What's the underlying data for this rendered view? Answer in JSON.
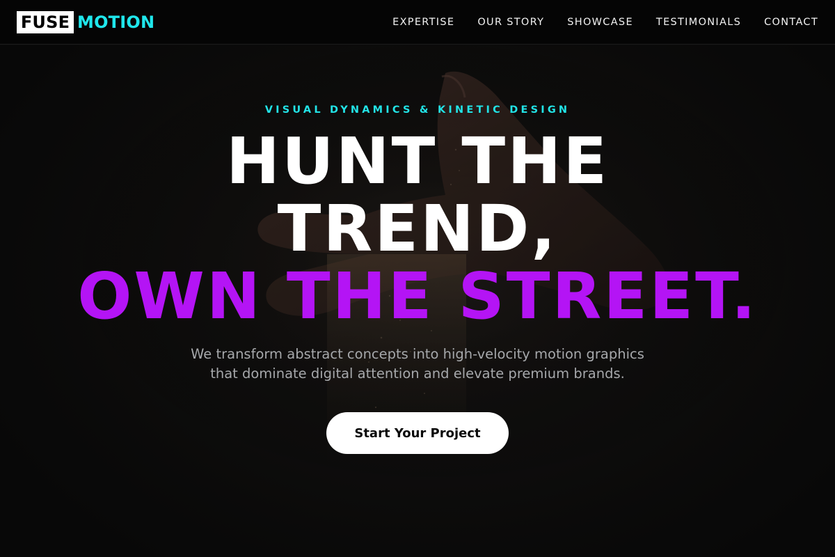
{
  "brand": {
    "logo_part1": "FUSE",
    "logo_part2": "MOTION",
    "accent_color": "#1fe7ec"
  },
  "nav": {
    "items": [
      "EXPERTISE",
      "OUR STORY",
      "SHOWCASE",
      "TESTIMONIALS",
      "CONTACT"
    ]
  },
  "hero": {
    "eyebrow": "VISUAL DYNAMICS & KINETIC DESIGN",
    "headline_line1": "HUNT THE",
    "headline_line2": "TREND,",
    "headline_line3": "OWN THE STREET.",
    "headline_accent_color": "#b414f5",
    "subtext_line1": "We transform abstract concepts into high-velocity motion graphics",
    "subtext_line2": "that dominate digital attention and elevate premium brands.",
    "cta_label": "Start Your Project",
    "background_image": "hand-releasing-sand-photo"
  }
}
